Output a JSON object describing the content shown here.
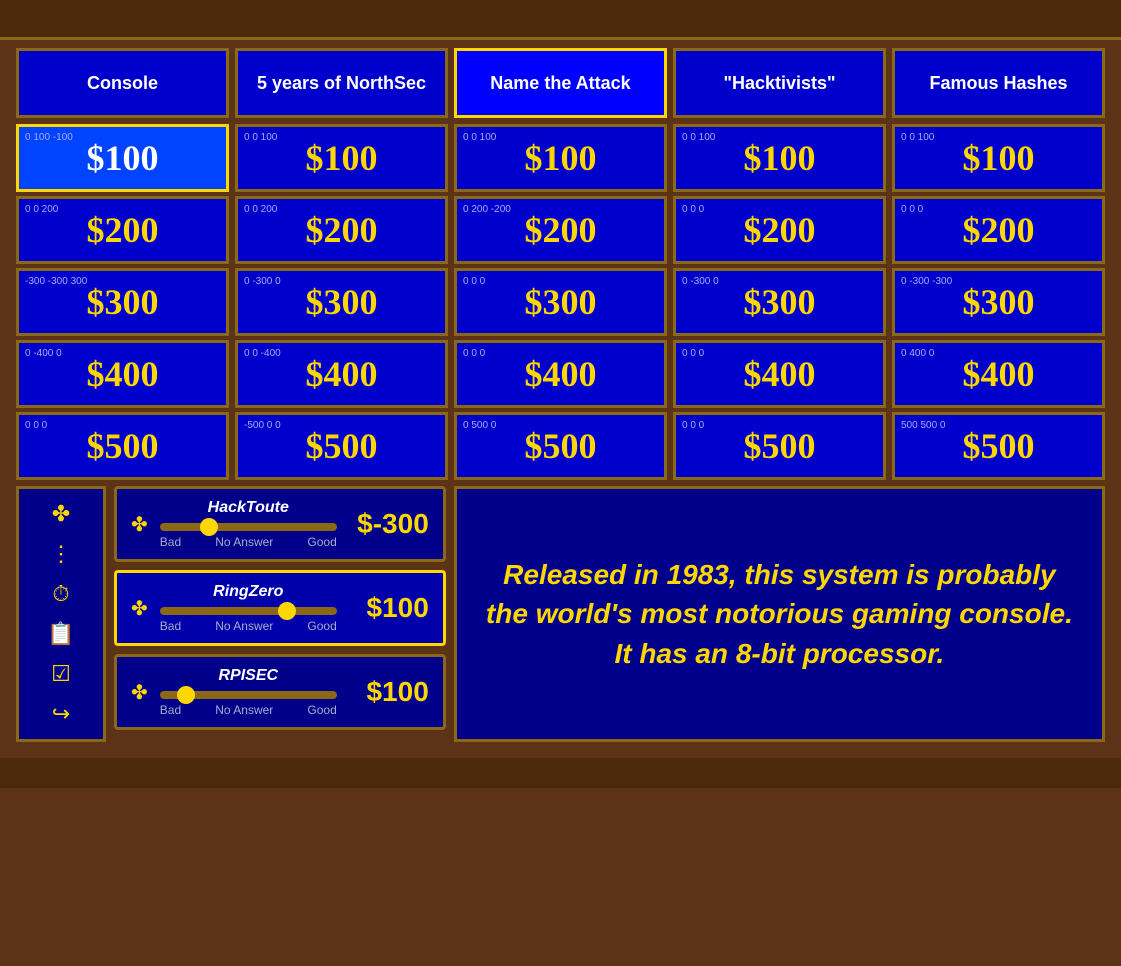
{
  "topbar": {},
  "categories": [
    {
      "id": "console",
      "label": "Console",
      "active": false
    },
    {
      "id": "northsec",
      "label": "5 years of NorthSec",
      "active": false
    },
    {
      "id": "attack",
      "label": "Name the Attack",
      "active": true
    },
    {
      "id": "hacktivists",
      "label": "\"Hacktivists\"",
      "active": false
    },
    {
      "id": "hashes",
      "label": "Famous Hashes",
      "active": false
    }
  ],
  "grid": [
    {
      "values": [
        {
          "scores": [
            "0",
            "100",
            "-100"
          ],
          "amount": "$100",
          "highlighted": true
        },
        {
          "scores": [
            "0",
            "0",
            "100"
          ],
          "amount": "$100",
          "highlighted": false
        },
        {
          "scores": [
            "0",
            "0",
            "100"
          ],
          "amount": "$100",
          "highlighted": false
        },
        {
          "scores": [
            "0",
            "0",
            "100"
          ],
          "amount": "$100",
          "highlighted": false
        },
        {
          "scores": [
            "0",
            "0",
            "100"
          ],
          "amount": "$100",
          "highlighted": false
        }
      ]
    },
    {
      "values": [
        {
          "scores": [
            "0",
            "0",
            "200"
          ],
          "amount": "$200",
          "highlighted": false
        },
        {
          "scores": [
            "0",
            "0",
            "200"
          ],
          "amount": "$200",
          "highlighted": false
        },
        {
          "scores": [
            "0",
            "200",
            "-200"
          ],
          "amount": "$200",
          "highlighted": false
        },
        {
          "scores": [
            "0",
            "0",
            "0"
          ],
          "amount": "$200",
          "highlighted": false
        },
        {
          "scores": [
            "0",
            "0",
            "0"
          ],
          "amount": "$200",
          "highlighted": false
        }
      ]
    },
    {
      "values": [
        {
          "scores": [
            "-300",
            "-300",
            "300"
          ],
          "amount": "$300",
          "highlighted": false
        },
        {
          "scores": [
            "0",
            "-300",
            "0"
          ],
          "amount": "$300",
          "highlighted": false
        },
        {
          "scores": [
            "0",
            "0",
            "0"
          ],
          "amount": "$300",
          "highlighted": false
        },
        {
          "scores": [
            "0",
            "-300",
            "0"
          ],
          "amount": "$300",
          "highlighted": false
        },
        {
          "scores": [
            "0",
            "-300",
            "-300"
          ],
          "amount": "$300",
          "highlighted": false
        }
      ]
    },
    {
      "values": [
        {
          "scores": [
            "0",
            "-400",
            "0"
          ],
          "amount": "$400",
          "highlighted": false
        },
        {
          "scores": [
            "0",
            "0",
            "-400"
          ],
          "amount": "$400",
          "highlighted": false
        },
        {
          "scores": [
            "0",
            "0",
            "0"
          ],
          "amount": "$400",
          "highlighted": false
        },
        {
          "scores": [
            "0",
            "0",
            "0"
          ],
          "amount": "$400",
          "highlighted": false
        },
        {
          "scores": [
            "0",
            "400",
            "0"
          ],
          "amount": "$400",
          "highlighted": false
        }
      ]
    },
    {
      "values": [
        {
          "scores": [
            "0",
            "0",
            "0"
          ],
          "amount": "$500",
          "highlighted": false
        },
        {
          "scores": [
            "-500",
            "0",
            "0"
          ],
          "amount": "$500",
          "highlighted": false
        },
        {
          "scores": [
            "0",
            "500",
            "0"
          ],
          "amount": "$500",
          "highlighted": false
        },
        {
          "scores": [
            "0",
            "0",
            "0"
          ],
          "amount": "$500",
          "highlighted": false
        },
        {
          "scores": [
            "500",
            "500",
            "0"
          ],
          "amount": "$500",
          "highlighted": false
        }
      ]
    }
  ],
  "teams": [
    {
      "name": "HackToute",
      "score": "$-300",
      "sliderPos": 28,
      "labels": [
        "Bad",
        "No Answer",
        "Good"
      ]
    },
    {
      "name": "RingZero",
      "score": "$100",
      "sliderPos": 72,
      "labels": [
        "Bad",
        "No Answer",
        "Good"
      ]
    },
    {
      "name": "RPISEC",
      "score": "$100",
      "sliderPos": 15,
      "labels": [
        "Bad",
        "No Answer",
        "Good"
      ]
    }
  ],
  "sidebar": {
    "icons": [
      "✤",
      "⋮",
      "⏱",
      "📋",
      "☑",
      "↪"
    ]
  },
  "question": {
    "text": "Released in 1983, this system is probably the world's most notorious gaming console. It has an 8-bit processor."
  }
}
